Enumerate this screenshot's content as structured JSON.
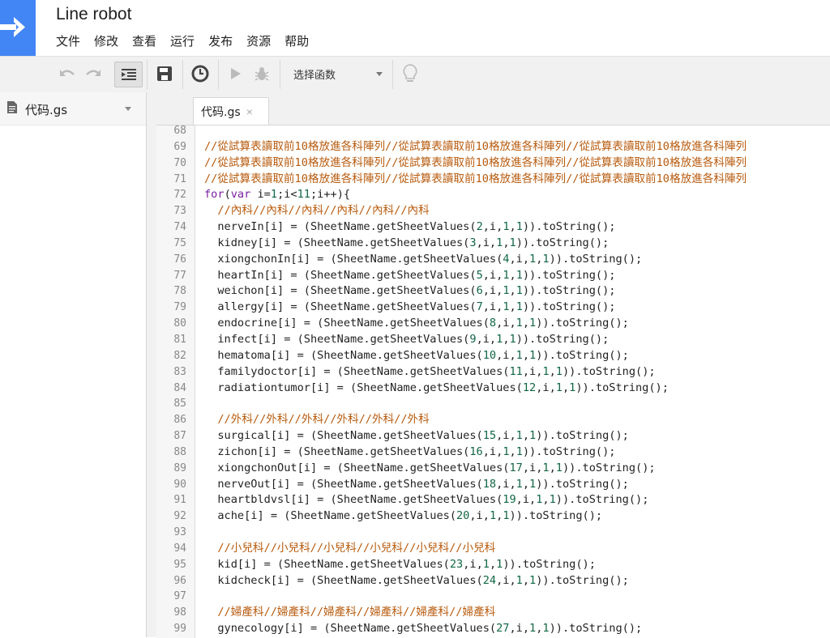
{
  "app": {
    "title": "Line robot",
    "logo_icon": "arrow-right-icon",
    "accent_color": "#4285f4"
  },
  "menu": [
    "文件",
    "修改",
    "查看",
    "运行",
    "发布",
    "资源",
    "帮助"
  ],
  "toolbar": {
    "buttons": [
      {
        "name": "undo-icon"
      },
      {
        "name": "redo-icon"
      },
      {
        "name": "indent-icon"
      },
      {
        "name": "save-icon"
      },
      {
        "name": "clock-icon"
      },
      {
        "name": "play-icon"
      },
      {
        "name": "bug-icon"
      },
      {
        "name": "lightbulb-icon"
      }
    ],
    "function_select": "选择函数"
  },
  "sidebar": {
    "files": [
      {
        "label": "代码.gs",
        "icon": "document-icon"
      }
    ]
  },
  "editor": {
    "tab_label": "代码.gs",
    "tab_close": "×",
    "lines": [
      {
        "n": "68",
        "text": ""
      },
      {
        "n": "69",
        "text": "//從試算表讀取前10格放進各科陣列//從試算表讀取前10格放進各科陣列//從試算表讀取前10格放進各科陣列"
      },
      {
        "n": "70",
        "text": "//從試算表讀取前10格放進各科陣列//從試算表讀取前10格放進各科陣列//從試算表讀取前10格放進各科陣列"
      },
      {
        "n": "71",
        "text": "//從試算表讀取前10格放進各科陣列//從試算表讀取前10格放進各科陣列//從試算表讀取前10格放進各科陣列"
      },
      {
        "n": "72",
        "text": "for(var i=1;i<11;i++){"
      },
      {
        "n": "73",
        "text": "  //內科//內科//內科//內科//內科//內科"
      },
      {
        "n": "74",
        "text": "  nerveIn[i] = (SheetName.getSheetValues(2,i,1,1)).toString();"
      },
      {
        "n": "75",
        "text": "  kidney[i] = (SheetName.getSheetValues(3,i,1,1)).toString();"
      },
      {
        "n": "76",
        "text": "  xiongchonIn[i] = (SheetName.getSheetValues(4,i,1,1)).toString();"
      },
      {
        "n": "77",
        "text": "  heartIn[i] = (SheetName.getSheetValues(5,i,1,1)).toString();"
      },
      {
        "n": "78",
        "text": "  weichon[i] = (SheetName.getSheetValues(6,i,1,1)).toString();"
      },
      {
        "n": "79",
        "text": "  allergy[i] = (SheetName.getSheetValues(7,i,1,1)).toString();"
      },
      {
        "n": "80",
        "text": "  endocrine[i] = (SheetName.getSheetValues(8,i,1,1)).toString();"
      },
      {
        "n": "81",
        "text": "  infect[i] = (SheetName.getSheetValues(9,i,1,1)).toString();"
      },
      {
        "n": "82",
        "text": "  hematoma[i] = (SheetName.getSheetValues(10,i,1,1)).toString();"
      },
      {
        "n": "83",
        "text": "  familydoctor[i] = (SheetName.getSheetValues(11,i,1,1)).toString();"
      },
      {
        "n": "84",
        "text": "  radiationtumor[i] = (SheetName.getSheetValues(12,i,1,1)).toString();"
      },
      {
        "n": "85",
        "text": ""
      },
      {
        "n": "86",
        "text": "  //外科//外科//外科//外科//外科//外科"
      },
      {
        "n": "87",
        "text": "  surgical[i] = (SheetName.getSheetValues(15,i,1,1)).toString();"
      },
      {
        "n": "88",
        "text": "  zichon[i] = (SheetName.getSheetValues(16,i,1,1)).toString();"
      },
      {
        "n": "89",
        "text": "  xiongchonOut[i] = (SheetName.getSheetValues(17,i,1,1)).toString();"
      },
      {
        "n": "90",
        "text": "  nerveOut[i] = (SheetName.getSheetValues(18,i,1,1)).toString();"
      },
      {
        "n": "91",
        "text": "  heartbldvsl[i] = (SheetName.getSheetValues(19,i,1,1)).toString();"
      },
      {
        "n": "92",
        "text": "  ache[i] = (SheetName.getSheetValues(20,i,1,1)).toString();"
      },
      {
        "n": "93",
        "text": ""
      },
      {
        "n": "94",
        "text": "  //小兒科//小兒科//小兒科//小兒科//小兒科//小兒科"
      },
      {
        "n": "95",
        "text": "  kid[i] = (SheetName.getSheetValues(23,i,1,1)).toString();"
      },
      {
        "n": "96",
        "text": "  kidcheck[i] = (SheetName.getSheetValues(24,i,1,1)).toString();"
      },
      {
        "n": "97",
        "text": ""
      },
      {
        "n": "98",
        "text": "  //婦產科//婦產科//婦產科//婦產科//婦產科//婦產科"
      },
      {
        "n": "99",
        "text": "  gynecology[i] = (SheetName.getSheetValues(27,i,1,1)).toString();"
      }
    ]
  }
}
